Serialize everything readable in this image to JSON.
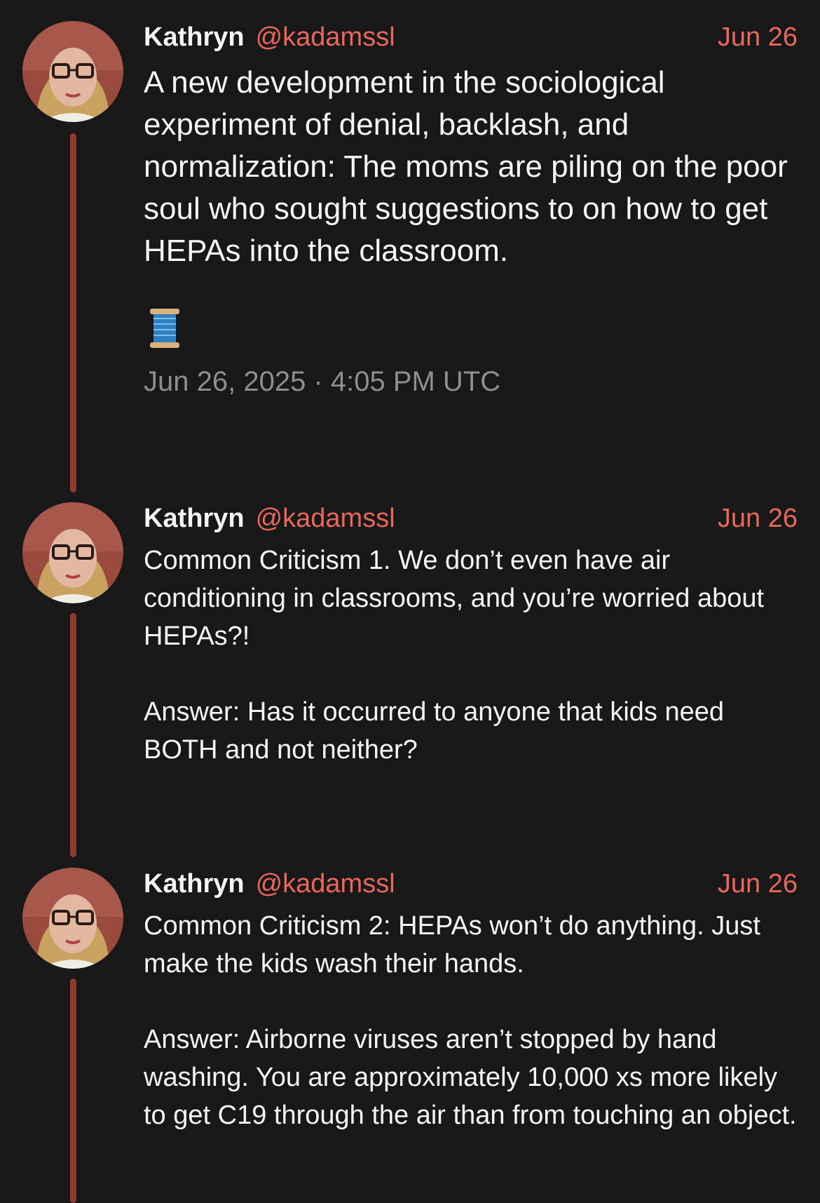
{
  "thread": {
    "posts": [
      {
        "author_name": "Kathryn",
        "handle": "@kadamssl",
        "date": "Jun 26",
        "text": "A new development in the sociological experiment of denial, backlash, and normalization: The moms are piling on the poor soul who sought suggestions to on how to get HEPAs into the classroom.",
        "emoji_icon": "spool-of-thread-icon",
        "timestamp": "Jun 26, 2025 · 4:05 PM UTC"
      },
      {
        "author_name": "Kathryn",
        "handle": "@kadamssl",
        "date": "Jun 26",
        "text": "Common Criticism 1. We don’t even have air conditioning in classrooms, and you’re worried about HEPAs?!\n\nAnswer: Has it occurred to anyone that kids need BOTH and not neither?"
      },
      {
        "author_name": "Kathryn",
        "handle": "@kadamssl",
        "date": "Jun 26",
        "text": "Common Criticism 2: HEPAs won’t do anything. Just make the kids wash their hands.\n\nAnswer: Airborne viruses aren’t stopped by hand washing. You are approximately 10,000 xs more likely to get C19 through the air than from touching an object."
      }
    ]
  },
  "colors": {
    "background": "#181818",
    "accent": "#e8675a",
    "thread_line": "#8c3a32",
    "muted": "#8e8e8e"
  }
}
